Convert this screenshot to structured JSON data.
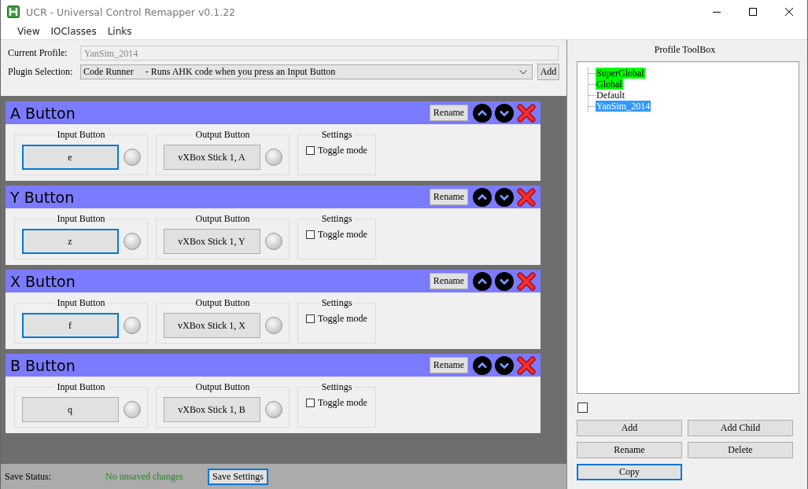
{
  "window": {
    "title": "UCR - Universal Control Remapper v0.1.22"
  },
  "menu": [
    "View",
    "IOClasses",
    "Links"
  ],
  "profile": {
    "current_label": "Current Profile:",
    "current_value": "YanSim_2014",
    "plugin_label": "Plugin Selection:",
    "plugin_value": "Code Runner     - Runs AHK code when you press an Input Button",
    "add_button": "Add"
  },
  "plugins": [
    {
      "name": "A Button",
      "rename": "Rename",
      "input_title": "Input Button",
      "input_value": "e",
      "input_focused": true,
      "output_title": "Output Button",
      "output_value": "vXBox Stick 1, A",
      "settings_title": "Settings",
      "toggle_label": "Toggle mode",
      "toggle_checked": false
    },
    {
      "name": "Y Button",
      "rename": "Rename",
      "input_title": "Input Button",
      "input_value": "z",
      "input_focused": true,
      "output_title": "Output Button",
      "output_value": "vXBox Stick 1, Y",
      "settings_title": "Settings",
      "toggle_label": "Toggle mode",
      "toggle_checked": false
    },
    {
      "name": "X Button",
      "rename": "Rename",
      "input_title": "Input Button",
      "input_value": "f",
      "input_focused": true,
      "output_title": "Output Button",
      "output_value": "vXBox Stick 1, X",
      "settings_title": "Settings",
      "toggle_label": "Toggle mode",
      "toggle_checked": false
    },
    {
      "name": "B Button",
      "rename": "Rename",
      "input_title": "Input Button",
      "input_value": "q",
      "input_focused": false,
      "output_title": "Output Button",
      "output_value": "vXBox Stick 1, B",
      "settings_title": "Settings",
      "toggle_label": "Toggle mode",
      "toggle_checked": false
    }
  ],
  "status_bar": {
    "label": "Save Status:",
    "status": "No unsaved changes",
    "save_button": "Save Settings"
  },
  "toolbox": {
    "title": "Profile ToolBox",
    "tree": [
      {
        "label": "SuperGlobal",
        "color": "#00ff00",
        "selected": false
      },
      {
        "label": "Global",
        "color": "#00ff00",
        "selected": false
      },
      {
        "label": "Default",
        "selected": false
      },
      {
        "label": "YanSim_2014",
        "selected": true
      }
    ],
    "checkbox_checked": false,
    "buttons": [
      {
        "label": "Add",
        "focused": false
      },
      {
        "label": "Add Child",
        "focused": false
      },
      {
        "label": "Rename",
        "focused": false
      },
      {
        "label": "Delete",
        "focused": false
      },
      {
        "label": "Copy",
        "focused": true
      }
    ]
  }
}
